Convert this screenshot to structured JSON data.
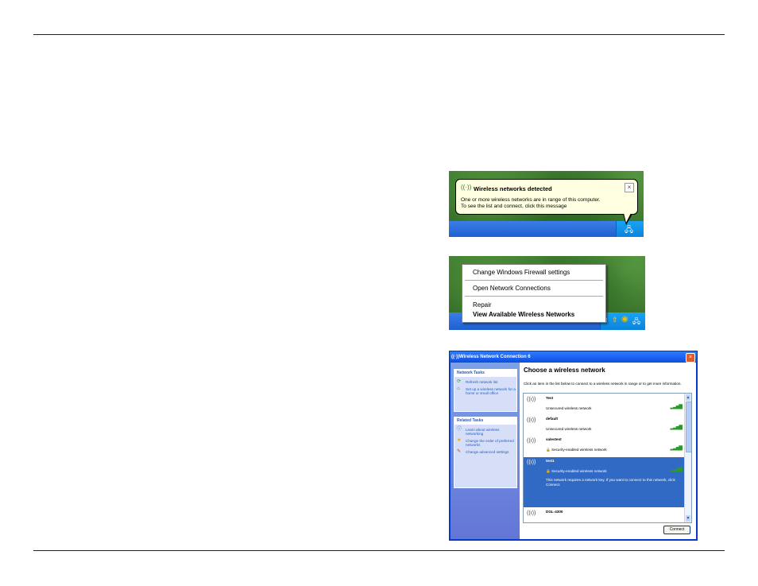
{
  "balloon": {
    "title": "Wireless networks detected",
    "line1": "One or more wireless networks are in range of this computer.",
    "line2": "To see the list and connect, click this message",
    "close": "×",
    "icon": "wireless-icon"
  },
  "context_menu": {
    "items": [
      "Change Windows Firewall settings",
      "Open Network Connections",
      "Repair",
      "View Available Wireless Networks"
    ]
  },
  "dialog": {
    "title": "Wireless Network Connection 6",
    "close": "×",
    "network_tasks": {
      "header": "Network Tasks",
      "items": [
        "Refresh network list",
        "Set up a wireless network for a home or small office"
      ]
    },
    "related_tasks": {
      "header": "Related Tasks",
      "items": [
        "Learn about wireless networking",
        "Change the order of preferred networks",
        "Change advanced settings"
      ]
    },
    "heading": "Choose a wireless network",
    "subtext": "Click an item in the list below to connect to a wireless network in range or to get more information.",
    "networks": [
      {
        "name": "Test",
        "type": "Unsecured wireless network"
      },
      {
        "name": "default",
        "type": "Unsecured wireless network"
      },
      {
        "name": "salestest",
        "type": "Security-enabled wireless network"
      },
      {
        "name": "test1",
        "type": "Security-enabled wireless network",
        "description": "This network requires a network key. If you want to connect to this network, click Connect."
      },
      {
        "name": "DGL-4300",
        "type": ""
      }
    ],
    "connect_label": "Connect"
  },
  "colors": {
    "taskbar": "#245edc",
    "selection": "#316ac5",
    "balloon": "#ffffe1"
  }
}
